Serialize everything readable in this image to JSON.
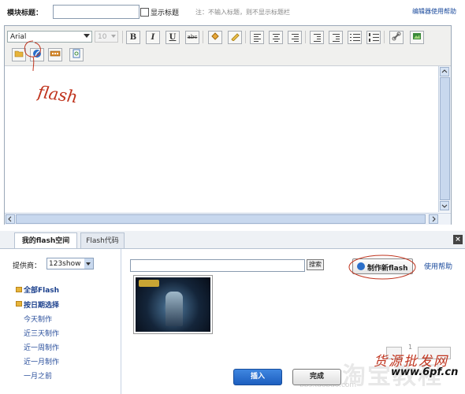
{
  "top": {
    "title_label": "模块标题：",
    "title_value": "",
    "show_title_label": "显示标题",
    "note": "注：不输入标题，则不显示标题栏",
    "help_link": "编辑器使用帮助"
  },
  "editor": {
    "font_name": "Arial",
    "font_size": "10",
    "bold": "B",
    "italic": "I",
    "underline": "U",
    "strike": "abc",
    "annotation": "flash"
  },
  "panel": {
    "tabs": [
      "我的flash空间",
      "Flash代码"
    ],
    "close": "×",
    "provider_label": "提供商：",
    "provider_value": "123show",
    "all_flash": "全部Flash",
    "by_date": "按日期选择",
    "dates": [
      "今天制作",
      "近三天制作",
      "近一周制作",
      "近一月制作",
      "一月之前"
    ],
    "search_value": "",
    "search_button": "搜索",
    "make_button": "制作新flash",
    "help_link": "使用帮助",
    "insert_button": "插入",
    "done_button": "完成",
    "page_number": "1"
  },
  "watermarks": {
    "taobao": "淘宝教程",
    "url": "bbs.taobao.com",
    "site": "货源批发网",
    "domain": "www.6pf.cn"
  },
  "colors": {
    "link": "#1a4a9c",
    "annotation": "#c0351f",
    "insert_button": "#1d5fbf"
  }
}
